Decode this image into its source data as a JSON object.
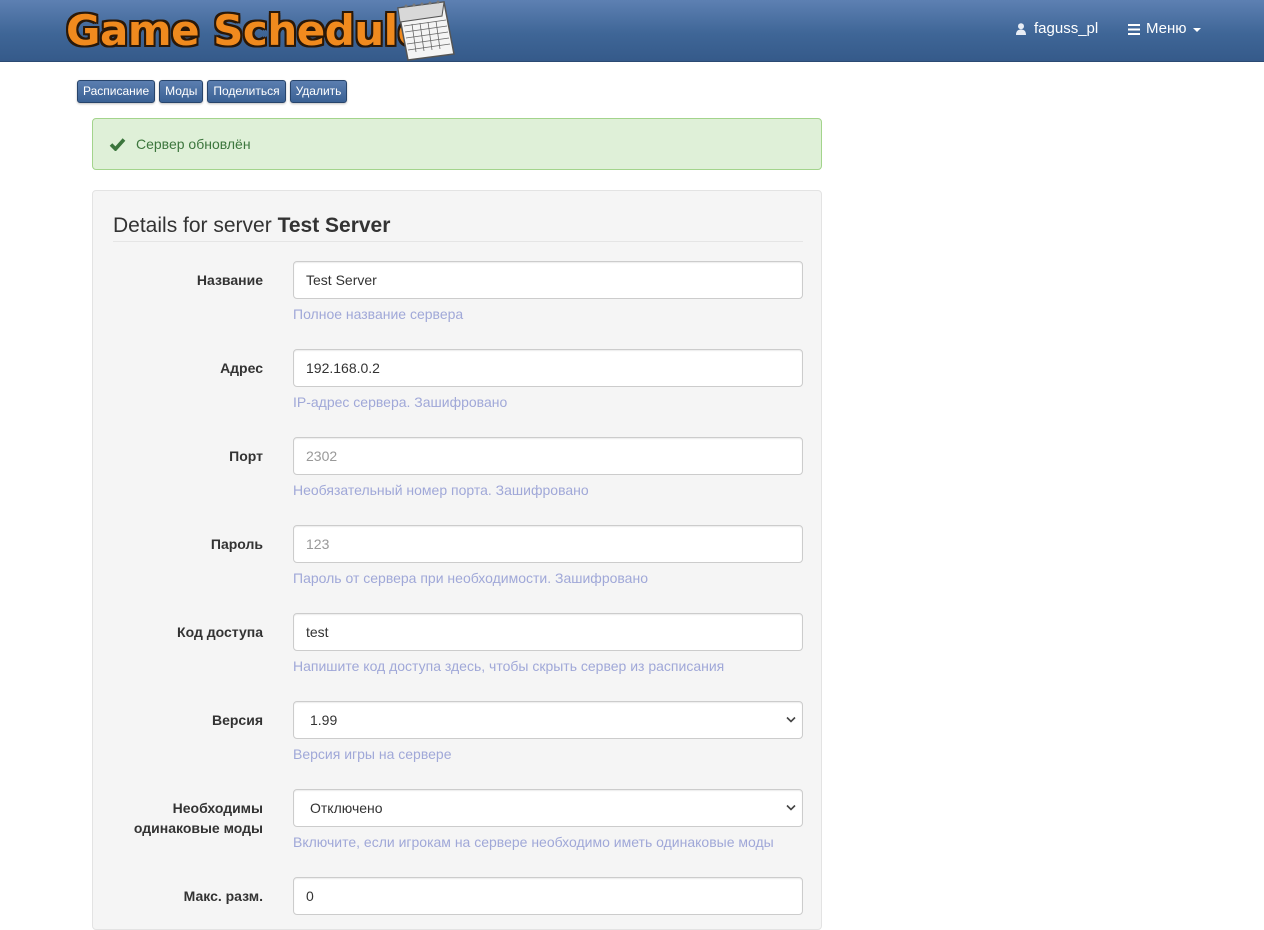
{
  "header": {
    "logo_text": "Game Schedule",
    "user_name": "faguss_pl",
    "menu_label": "Меню"
  },
  "actions": [
    "Расписание",
    "Моды",
    "Поделиться",
    "Удалить"
  ],
  "alert": {
    "text": "Сервер обновлён",
    "color": "#3c763d"
  },
  "panel": {
    "legend_prefix": "Details for server",
    "legend_name": "Test Server"
  },
  "fields": {
    "name": {
      "label": "Название",
      "value": "Test Server",
      "help": "Полное название сервера"
    },
    "address": {
      "label": "Адрес",
      "value": "192.168.0.2",
      "help": "IP-адрес сервера. Зашифровано"
    },
    "port": {
      "label": "Порт",
      "placeholder": "2302",
      "help": "Необязательный номер порта. Зашифровано"
    },
    "password": {
      "label": "Пароль",
      "placeholder": "123",
      "help": "Пароль от сервера при необходимости. Зашифровано"
    },
    "access_code": {
      "label": "Код доступа",
      "value": "test",
      "help": "Напишите код доступа здесь, чтобы скрыть сервер из расписания"
    },
    "version": {
      "label": "Версия",
      "value": "1.99",
      "help": "Версия игры на сервере"
    },
    "equal_mods": {
      "label_line1": "Необходимы",
      "label_line2": "одинаковые моды",
      "value": "Отключено",
      "help": "Включите, если игрокам на сервере необходимо иметь одинаковые моды"
    },
    "max_size": {
      "label": "Макс. разм.",
      "value": "0"
    }
  },
  "colors": {
    "navbar": "#3f6697",
    "logo": "#f08a1e",
    "button": "#3a6194",
    "alert_bg": "#dff0d8",
    "help_text": "#a0a8d8"
  }
}
